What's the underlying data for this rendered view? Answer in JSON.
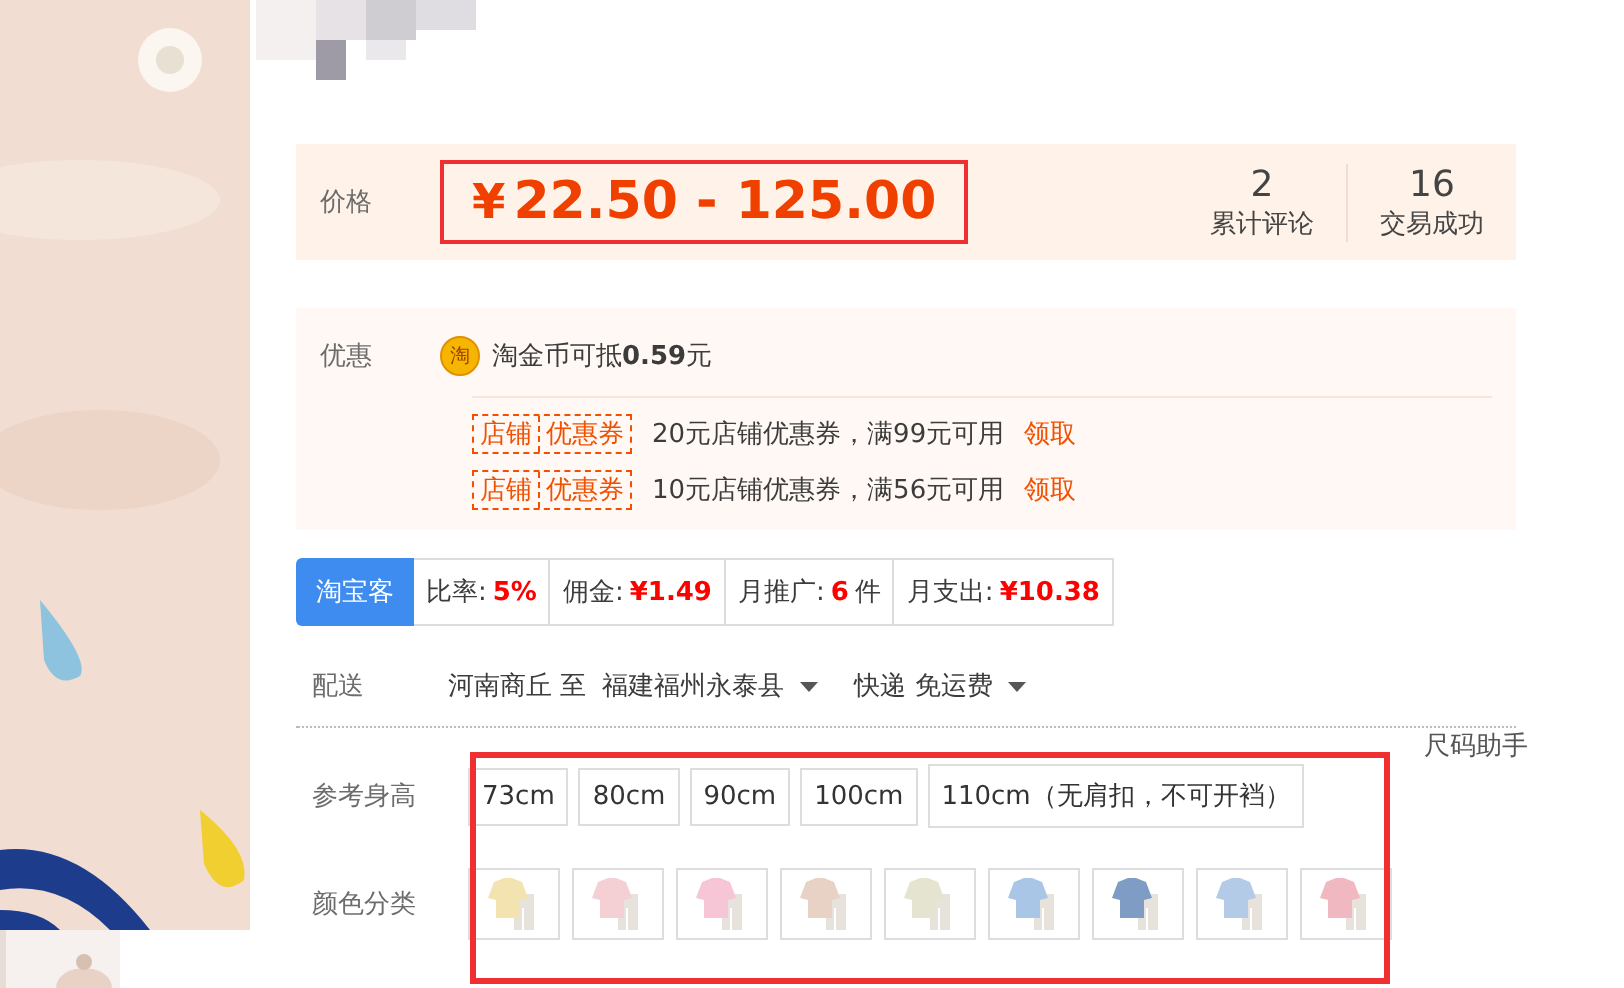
{
  "price": {
    "label": "价格",
    "currency": "¥",
    "value": "22.50 - 125.00"
  },
  "stats": [
    {
      "number": "2",
      "label": "累计评论"
    },
    {
      "number": "16",
      "label": "交易成功"
    }
  ],
  "promotions": {
    "label": "优惠",
    "coin_icon": "淘",
    "coin_text": "淘金币可抵**0.59**元",
    "coupons": [
      {
        "tag_left": "店铺",
        "tag_right": "优惠券",
        "text": "20元店铺优惠券，满99元可用",
        "link": "领取"
      },
      {
        "tag_left": "店铺",
        "tag_right": "优惠券",
        "text": "10元店铺优惠券，满56元可用",
        "link": "领取"
      }
    ]
  },
  "taobaoke": {
    "badge": "淘宝客",
    "cells": [
      {
        "label": "比率:",
        "value": "5%"
      },
      {
        "label": "佣金:",
        "value": "¥1.49"
      },
      {
        "label": "月推广:",
        "value": "6",
        "unit": "件"
      },
      {
        "label": "月支出:",
        "value": "¥10.38"
      }
    ]
  },
  "delivery": {
    "label": "配送",
    "from": "河南商丘 至",
    "to": "福建福州永泰县",
    "method": "快递 免运费"
  },
  "size_helper": "尺码助手",
  "heights": {
    "label": "参考身高",
    "options": [
      {
        "text": "73cm",
        "selected": false
      },
      {
        "text": "80cm",
        "selected": false
      },
      {
        "text": "90cm",
        "selected": false
      },
      {
        "text": "100cm",
        "selected": false
      },
      {
        "text": "110cm（无肩扣，不可开裆）",
        "selected": false
      }
    ]
  },
  "colors": {
    "label": "颜色分类",
    "options": [
      {
        "color": "#f2e3b0",
        "selected": false
      },
      {
        "color": "#f4cfd4",
        "selected": false
      },
      {
        "color": "#f7c6d6",
        "selected": false
      },
      {
        "color": "#e8d2c6",
        "selected": false
      },
      {
        "color": "#e4e4d0",
        "selected": false
      },
      {
        "color": "#a9c6e6",
        "selected": false
      },
      {
        "color": "#7f9cc4",
        "selected": false
      },
      {
        "color": "#b4cbe8",
        "selected": false
      },
      {
        "color": "#f0b8c0",
        "selected": false
      }
    ]
  }
}
